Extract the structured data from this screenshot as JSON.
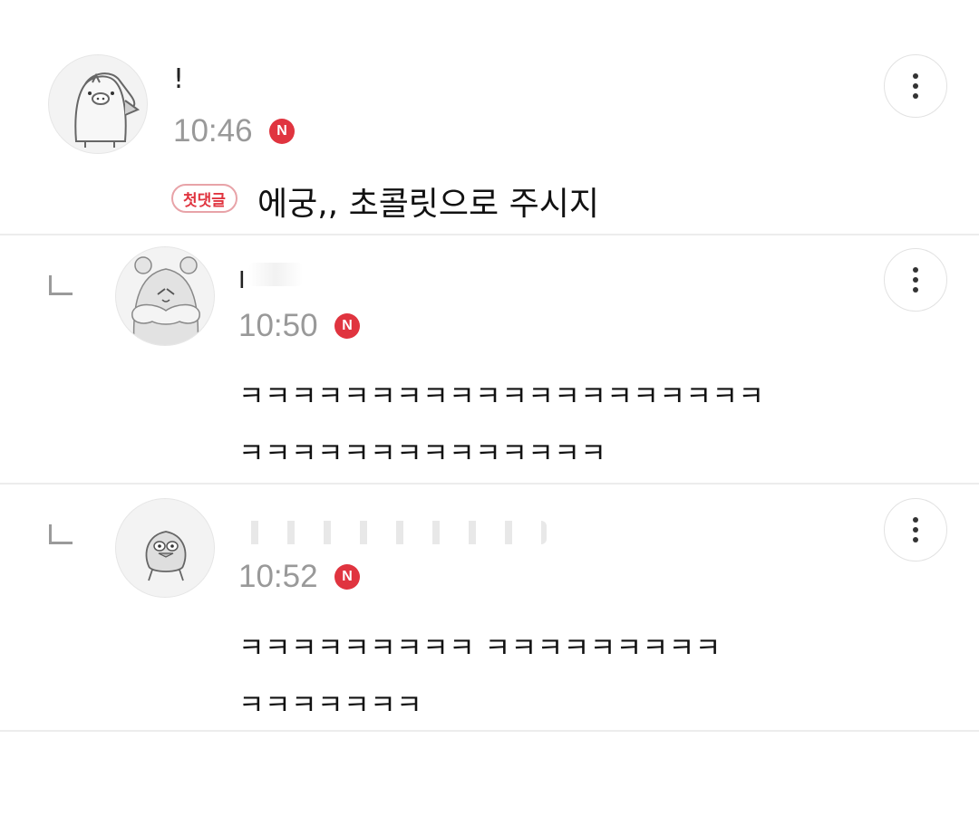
{
  "comments": [
    {
      "nickname": "!",
      "time": "10:46",
      "new_badge": "N",
      "first_comment_badge": "첫댓글",
      "text": "에궁,, 초콜릿으로 주시지",
      "more_icon": "more-vertical-icon",
      "is_reply": false
    },
    {
      "nickname": "I",
      "time": "10:50",
      "new_badge": "N",
      "text_lines": [
        "ㅋㅋㅋㅋㅋㅋㅋㅋㅋㅋㅋㅋㅋㅋㅋㅋㅋㅋㅋㅋ",
        "ㅋㅋㅋㅋㅋㅋㅋㅋㅋㅋㅋㅋㅋㅋ"
      ],
      "more_icon": "more-vertical-icon",
      "is_reply": true
    },
    {
      "nickname": "",
      "time": "10:52",
      "new_badge": "N",
      "text_lines": [
        "ㅋㅋㅋㅋㅋㅋㅋㅋㅋ  ㅋㅋㅋㅋㅋㅋㅋㅋㅋ",
        "ㅋㅋㅋㅋㅋㅋㅋ"
      ],
      "more_icon": "more-vertical-icon",
      "is_reply": true
    }
  ],
  "colors": {
    "new_badge": "#e0343f",
    "time": "#999999",
    "divider": "#ececec"
  }
}
